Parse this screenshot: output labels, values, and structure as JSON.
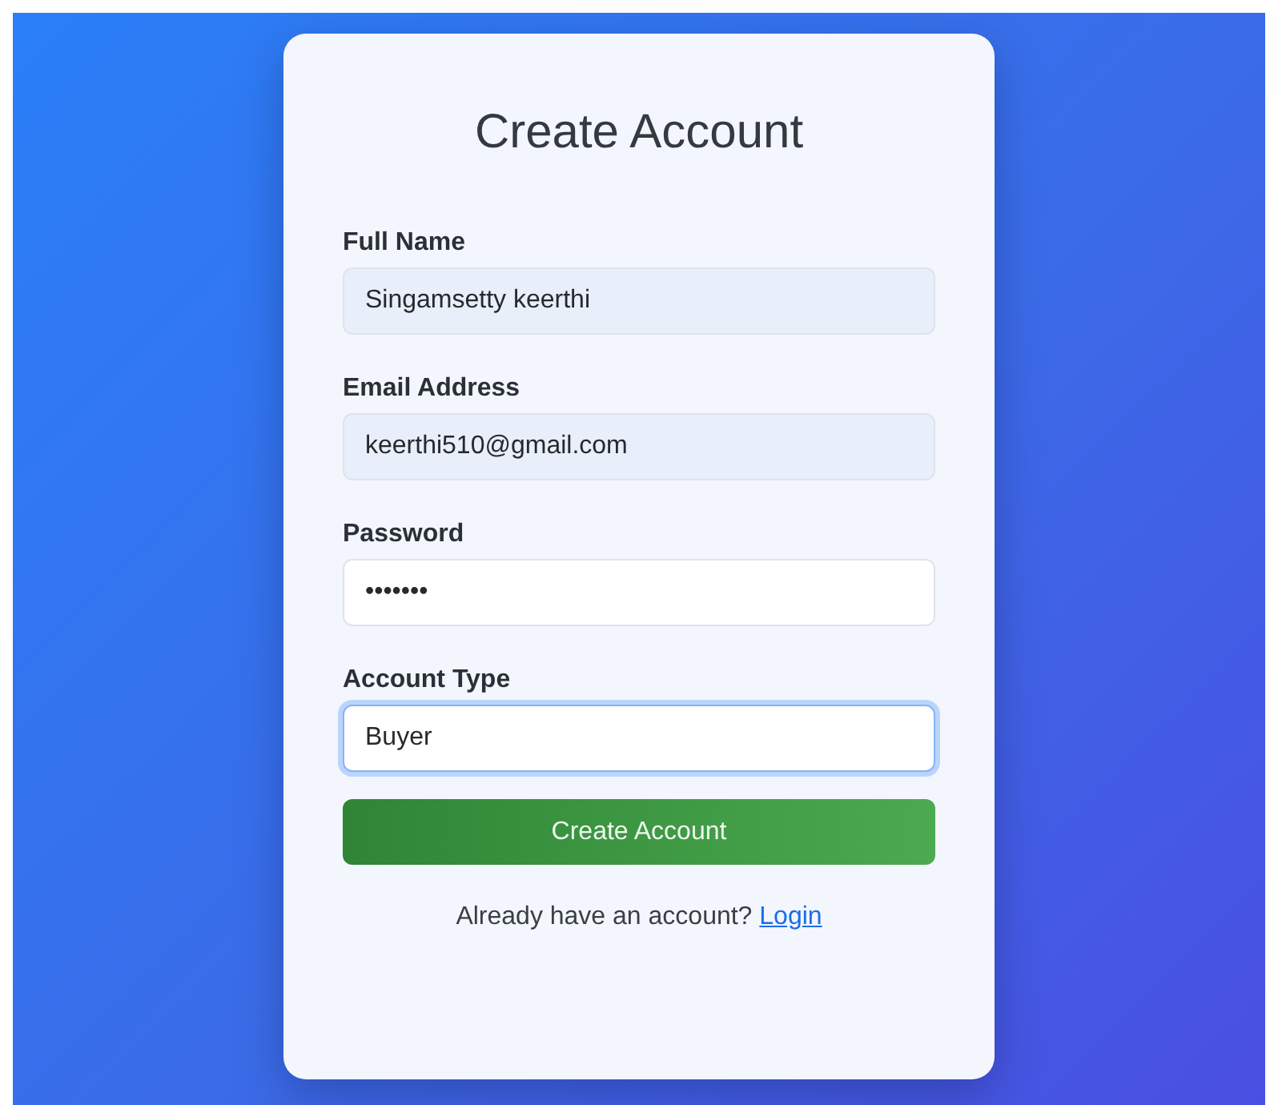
{
  "title": "Create Account",
  "fields": [
    {
      "label": "Full Name",
      "value": "Singamsetty keerthi",
      "autofilled": true,
      "focused": false
    },
    {
      "label": "Email Address",
      "value": "keerthi510@gmail.com",
      "autofilled": true,
      "focused": false
    },
    {
      "label": "Password",
      "value": "•••••••",
      "autofilled": false,
      "focused": false
    },
    {
      "label": "Account Type",
      "value": "Buyer",
      "autofilled": false,
      "focused": true
    }
  ],
  "submit": "Create Account",
  "footer": {
    "text": "Already have an account?",
    "link": "Login"
  }
}
